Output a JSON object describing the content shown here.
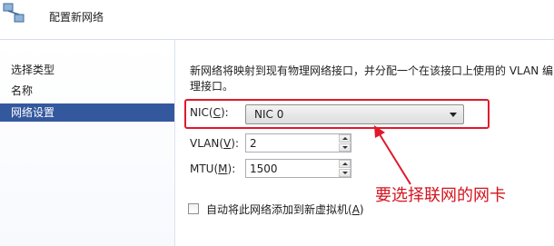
{
  "window": {
    "title": "配置新网络"
  },
  "nav": {
    "items": [
      {
        "label": "选择类型"
      },
      {
        "label": "名称"
      },
      {
        "label": "网络设置",
        "active": true
      }
    ]
  },
  "main": {
    "description": "新网络将映射到现有物理网络接口，并分配一个在该接口上使用的 VLAN 编理接口。",
    "nic": {
      "label_prefix": "NIC(",
      "hotkey": "C",
      "label_suffix": "):",
      "value": "NIC 0"
    },
    "vlan": {
      "label_prefix": "VLAN(",
      "hotkey": "V",
      "label_suffix": "):",
      "value": "2"
    },
    "mtu": {
      "label_prefix": "MTU(",
      "hotkey": "M",
      "label_suffix": "):",
      "value": "1500"
    },
    "auto_add": {
      "label_prefix": "自动将此网络添加到新虚拟机(",
      "hotkey": "A",
      "label_suffix": ")",
      "checked": false
    }
  },
  "annotation": {
    "text": "要选择联网的网卡",
    "color": "#d4141e"
  },
  "colors": {
    "nav_active": "#33589e",
    "highlight_box": "#e0192c"
  }
}
